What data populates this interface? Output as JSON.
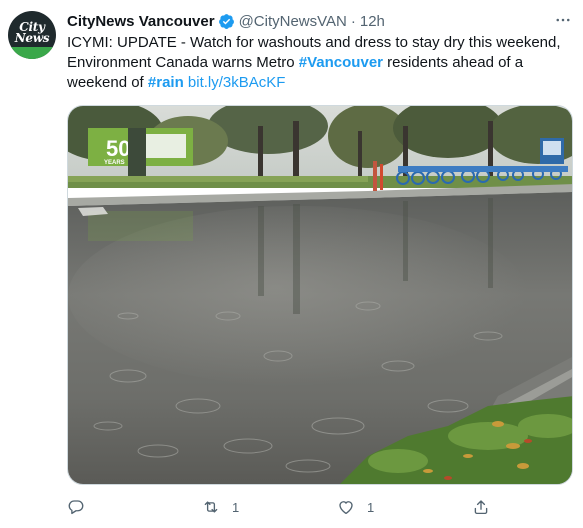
{
  "tweet": {
    "author": {
      "display_name": "CityNews Vancouver",
      "handle": "@CityNewsVAN",
      "avatar_text": [
        "City",
        "News"
      ]
    },
    "separator": "·",
    "time": "12h",
    "text": {
      "part1": "ICYMI: UPDATE - Watch for washouts and dress to stay dry this weekend, Environment Canada warns Metro ",
      "hashtag1": "#Vancouver",
      "part2": " residents ahead of a weekend of ",
      "hashtag2": "#rain",
      "space": " ",
      "link": "bit.ly/3kBAcKF"
    },
    "media": {
      "sign_text": "50",
      "sign_subtext": "YEARS"
    },
    "actions": {
      "reply_count": "",
      "retweet_count": "1",
      "like_count": "1"
    }
  },
  "colors": {
    "accent": "#1d9bf0",
    "secondary_text": "#536471",
    "primary_text": "#0f1419"
  }
}
